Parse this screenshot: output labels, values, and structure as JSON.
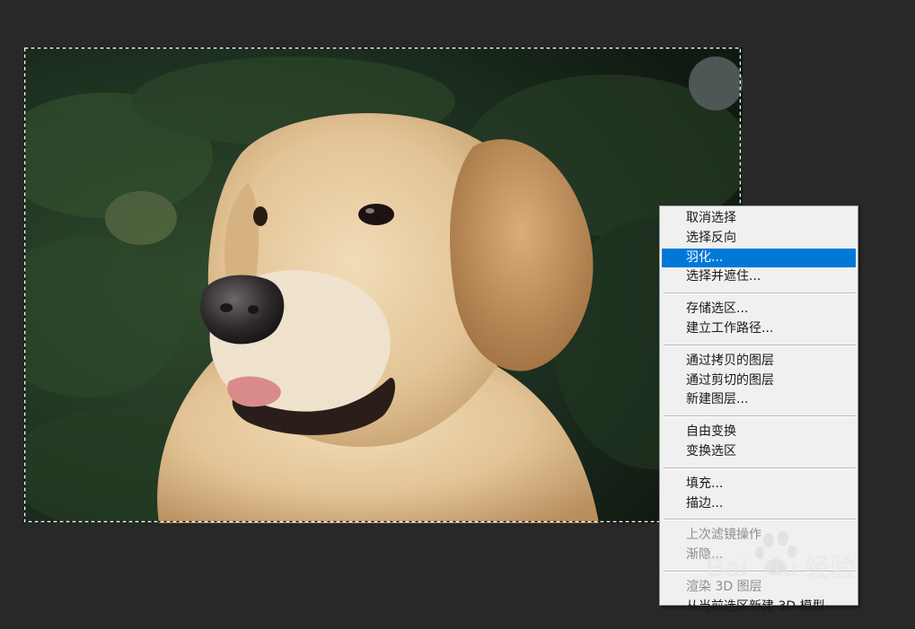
{
  "menu": {
    "groups": [
      [
        {
          "label": "取消选择",
          "state": "normal"
        },
        {
          "label": "选择反向",
          "state": "normal"
        },
        {
          "label": "羽化...",
          "state": "highlighted"
        },
        {
          "label": "选择并遮住...",
          "state": "normal"
        }
      ],
      [
        {
          "label": "存储选区...",
          "state": "normal"
        },
        {
          "label": "建立工作路径...",
          "state": "normal"
        }
      ],
      [
        {
          "label": "通过拷贝的图层",
          "state": "normal"
        },
        {
          "label": "通过剪切的图层",
          "state": "normal"
        },
        {
          "label": "新建图层...",
          "state": "normal"
        }
      ],
      [
        {
          "label": "自由变换",
          "state": "normal"
        },
        {
          "label": "变换选区",
          "state": "normal"
        }
      ],
      [
        {
          "label": "填充...",
          "state": "normal"
        },
        {
          "label": "描边...",
          "state": "normal"
        }
      ],
      [
        {
          "label": "上次滤镜操作",
          "state": "disabled"
        },
        {
          "label": "渐隐...",
          "state": "disabled"
        }
      ],
      [
        {
          "label": "渲染 3D 图层",
          "state": "disabled"
        },
        {
          "label": "从当前选区新建 3D 模型",
          "state": "normal"
        }
      ]
    ]
  },
  "watermark": {
    "brand_left": "Bai",
    "brand_right": "du",
    "suffix": "经验",
    "icon": "paw-icon"
  },
  "colors": {
    "workspace_bg": "#282828",
    "menu_bg": "#f0f0f0",
    "menu_highlight": "#0078d7",
    "menu_disabled_text": "#8e8e8e",
    "selection_marquee": "#ffffff"
  }
}
